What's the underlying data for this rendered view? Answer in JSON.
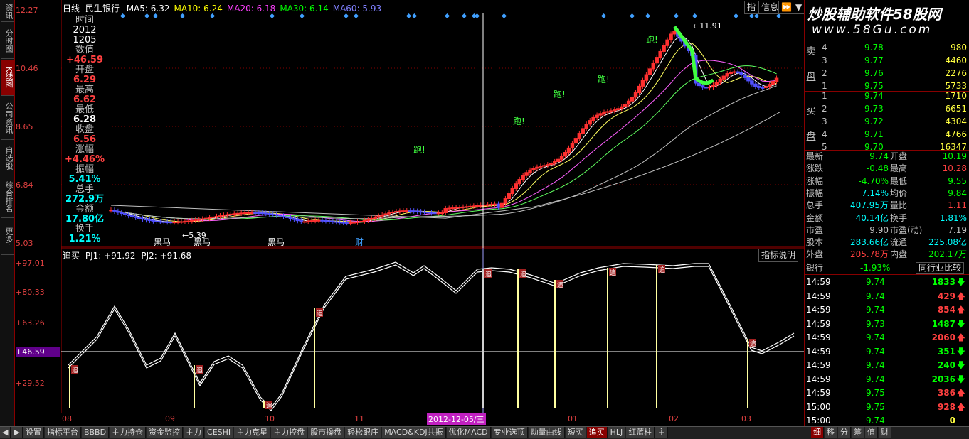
{
  "left_nav": [
    {
      "label": "资讯",
      "active": false
    },
    {
      "label": "分时图",
      "active": false
    },
    {
      "label": "K线图",
      "active": true
    },
    {
      "label": "公司资讯",
      "active": false
    },
    {
      "label": "自选股",
      "active": false
    },
    {
      "label": "综合排名",
      "active": false
    },
    {
      "label": "更多·",
      "active": false
    }
  ],
  "header": {
    "period": "日线",
    "stock": "民生银行",
    "ma": [
      {
        "label": "MA5: 6.32",
        "color": "#ffffff"
      },
      {
        "label": "MA10: 6.24",
        "color": "#ffff00"
      },
      {
        "label": "MA20: 6.18",
        "color": "#ff40ff"
      },
      {
        "label": "MA30: 6.14",
        "color": "#00ff00"
      },
      {
        "label": "MA60: 5.93",
        "color": "#8080ff"
      }
    ],
    "buttons": [
      "指",
      "信息",
      "⏩",
      "▼"
    ]
  },
  "price_axis": [
    "12.27",
    "10.46",
    "8.65",
    "6.84",
    "5.03"
  ],
  "info": {
    "time_label": "时间",
    "time_year": "2012",
    "time_date": "1205",
    "value_label": "数值",
    "value": "+46.59",
    "open_label": "开盘",
    "open": "6.29",
    "high_label": "最高",
    "high": "6.62",
    "low_label": "最低",
    "low": "6.28",
    "close_label": "收盘",
    "close": "6.56",
    "chg_label": "涨幅",
    "chg": "+4.46%",
    "amp_label": "振幅",
    "amp": "5.41%",
    "vol_label": "总手",
    "vol": "272.9万",
    "amt_label": "金额",
    "amt": "17.80亿",
    "turn_label": "换手",
    "turn": "1.21%"
  },
  "annotations": {
    "high_mark": "11.91",
    "low_mark": "5.39",
    "run": "跑!",
    "black_horse": "黑马",
    "cai": "财"
  },
  "indicator": {
    "name": "追买",
    "pj1": "PJ1: +91.92",
    "pj2": "PJ2: +91.68",
    "button": "指标说明",
    "axis": [
      "+97.01",
      "+80.33",
      "+63.26",
      "+46.59",
      "+29.52"
    ],
    "signal": "追"
  },
  "time_axis": {
    "months": [
      "08",
      "09",
      "10",
      "11",
      "01",
      "02",
      "03"
    ],
    "cursor_date": "2012-12-05/三"
  },
  "quote": {
    "watermark": "炒股辅助软件58股网",
    "site": "www.58Gu.com",
    "sell_label_1": "卖",
    "sell_label_2": "盘",
    "buy_label_1": "买",
    "buy_label_2": "盘",
    "sell": [
      {
        "n": "4",
        "p": "9.78",
        "v": "980"
      },
      {
        "n": "3",
        "p": "9.77",
        "v": "4460"
      },
      {
        "n": "2",
        "p": "9.76",
        "v": "2276"
      },
      {
        "n": "1",
        "p": "9.75",
        "v": "5733"
      }
    ],
    "buy": [
      {
        "n": "1",
        "p": "9.74",
        "v": "1710"
      },
      {
        "n": "2",
        "p": "9.73",
        "v": "6651"
      },
      {
        "n": "3",
        "p": "9.72",
        "v": "4304"
      },
      {
        "n": "4",
        "p": "9.71",
        "v": "4766"
      },
      {
        "n": "5",
        "p": "9.70",
        "v": "16347"
      }
    ],
    "stats": [
      {
        "k1": "最新",
        "v1": "9.74",
        "c1": "#00ff00",
        "k2": "开盘",
        "v2": "10.19",
        "c2": "#00ff00"
      },
      {
        "k1": "涨跌",
        "v1": "-0.48",
        "c1": "#00ff00",
        "k2": "最高",
        "v2": "10.28",
        "c2": "#ff4040"
      },
      {
        "k1": "涨幅",
        "v1": "-4.70%",
        "c1": "#00ff00",
        "k2": "最低",
        "v2": "9.55",
        "c2": "#00ff00"
      },
      {
        "k1": "振幅",
        "v1": "7.14%",
        "c1": "#00ffff",
        "k2": "均价",
        "v2": "9.84",
        "c2": "#00ff00"
      },
      {
        "k1": "总手",
        "v1": "407.95万",
        "c1": "#00ffff",
        "k2": "量比",
        "v2": "1.11",
        "c2": "#ff4040"
      },
      {
        "k1": "金额",
        "v1": "40.14亿",
        "c1": "#00ffff",
        "k2": "换手",
        "v2": "1.81%",
        "c2": "#00ffff"
      },
      {
        "k1": "市盈",
        "v1": "9.90",
        "c1": "#c0c0c0",
        "k2": "市盈(动)",
        "v2": "7.19",
        "c2": "#c0c0c0"
      },
      {
        "k1": "股本",
        "v1": "283.66亿",
        "c1": "#00ffff",
        "k2": "流通",
        "v2": "225.08亿",
        "c2": "#00ffff"
      },
      {
        "k1": "外盘",
        "v1": "205.78万",
        "c1": "#ff4040",
        "k2": "内盘",
        "v2": "202.17万",
        "c2": "#00ff00"
      }
    ],
    "industry": "银行",
    "industry_chg": "-1.93%",
    "compare_button": "同行业比较",
    "ticks": [
      {
        "t": "14:59",
        "p": "9.74",
        "v": "1833",
        "d": "down"
      },
      {
        "t": "14:59",
        "p": "9.74",
        "v": "429",
        "d": "up"
      },
      {
        "t": "14:59",
        "p": "9.74",
        "v": "854",
        "d": "up"
      },
      {
        "t": "14:59",
        "p": "9.73",
        "v": "1487",
        "d": "down"
      },
      {
        "t": "14:59",
        "p": "9.74",
        "v": "2060",
        "d": "up"
      },
      {
        "t": "14:59",
        "p": "9.74",
        "v": "351",
        "d": "down"
      },
      {
        "t": "14:59",
        "p": "9.74",
        "v": "240",
        "d": "down"
      },
      {
        "t": "14:59",
        "p": "9.74",
        "v": "2036",
        "d": "down"
      },
      {
        "t": "14:59",
        "p": "9.75",
        "v": "386",
        "d": "up"
      },
      {
        "t": "15:00",
        "p": "9.75",
        "v": "928",
        "d": "up"
      },
      {
        "t": "15:00",
        "p": "9.74",
        "v": "0",
        "d": "none"
      }
    ],
    "right_tabs": [
      "细",
      "移",
      "分",
      "筹",
      "值",
      "财"
    ]
  },
  "bottom_tabs": [
    "◀",
    "▶",
    "设置",
    "指标平台",
    "BBBD",
    "主力持仓",
    "资金监控",
    "主力",
    "CESHI",
    "主力克星",
    "主力控盘",
    "股市操盘",
    "轻松跟庄",
    "MACD&KDJ共振",
    "优化MACD",
    "专业选顶",
    "动量曲线",
    "短买",
    "追买",
    "HLJ",
    "红蓝柱",
    "主"
  ],
  "active_bottom_tab": "追买",
  "colors": {
    "up": "#ff3030",
    "down": "#5050ff",
    "axis": "#a00000",
    "grid": "#800000"
  }
}
